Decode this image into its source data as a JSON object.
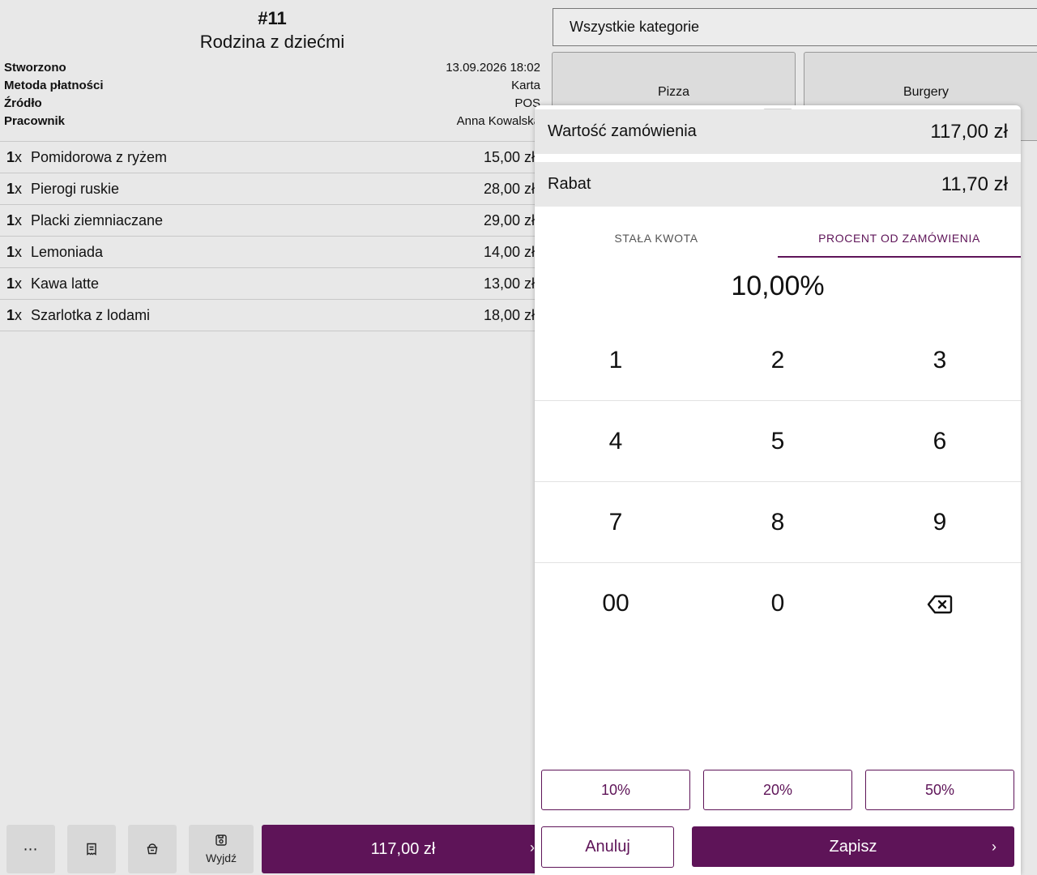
{
  "order": {
    "number": "#11",
    "name": "Rodzina z dziećmi",
    "meta": [
      {
        "label": "Stworzono",
        "value": "13.09.2026 18:02"
      },
      {
        "label": "Metoda płatności",
        "value": "Karta"
      },
      {
        "label": "Źródło",
        "value": "POS"
      },
      {
        "label": "Pracownik",
        "value": "Anna Kowalska"
      }
    ],
    "items": [
      {
        "qty": "1",
        "unit": "x",
        "name": "Pomidorowa z ryżem",
        "price": "15,00 zł"
      },
      {
        "qty": "1",
        "unit": "x",
        "name": "Pierogi ruskie",
        "price": "28,00 zł"
      },
      {
        "qty": "1",
        "unit": "x",
        "name": "Placki ziemniaczane",
        "price": "29,00 zł"
      },
      {
        "qty": "1",
        "unit": "x",
        "name": "Lemoniada",
        "price": "14,00 zł"
      },
      {
        "qty": "1",
        "unit": "x",
        "name": "Kawa latte",
        "price": "13,00 zł"
      },
      {
        "qty": "1",
        "unit": "x",
        "name": "Szarlotka z lodami",
        "price": "18,00 zł"
      }
    ]
  },
  "toolbar": {
    "more_label": "⋯",
    "exit_label": "Wyjdź",
    "total_label": "117,00 zł",
    "icons": [
      "more-icon",
      "receipt-icon",
      "basket-icon",
      "save-icon"
    ]
  },
  "categories": {
    "all_label": "Wszystkie kategorie",
    "tiles": [
      "Pizza",
      "Burgery"
    ]
  },
  "discount": {
    "order_value_label": "Wartość zamówienia",
    "order_value": "117,00 zł",
    "discount_label": "Rabat",
    "discount_value": "11,70 zł",
    "tabs": [
      "Stała kwota",
      "Procent od zamówienia"
    ],
    "active_tab": "Procent od zamówienia",
    "amount": "10,00%",
    "keys": [
      [
        "1",
        "2",
        "3"
      ],
      [
        "4",
        "5",
        "6"
      ],
      [
        "7",
        "8",
        "9"
      ],
      [
        "00",
        "0",
        "backspace"
      ]
    ],
    "presets": [
      "10%",
      "20%",
      "50%"
    ],
    "cancel_label": "Anuluj",
    "save_label": "Zapisz"
  },
  "colors": {
    "accent": "#5e1458",
    "background": "#e8e8e8",
    "sheet": "#ffffff"
  }
}
